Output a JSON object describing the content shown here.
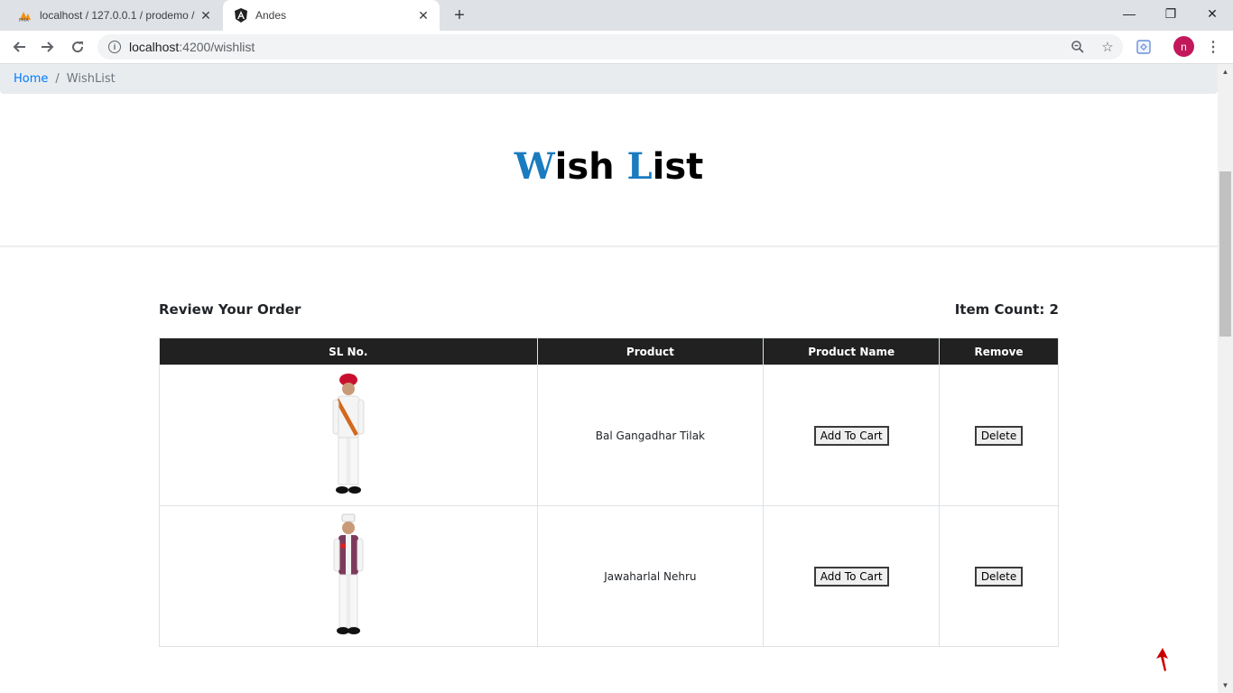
{
  "browser": {
    "tabs": [
      {
        "title": "localhost / 127.0.0.1 / prodemo / ",
        "favicon": "phpmyadmin-icon",
        "active": false
      },
      {
        "title": "Andes",
        "favicon": "angular-icon",
        "active": true
      }
    ],
    "address": {
      "host": "localhost",
      "path": ":4200/wishlist"
    },
    "avatar_initial": "n"
  },
  "breadcrumb": {
    "home": "Home",
    "separator": "/",
    "current": "WishList"
  },
  "heading": {
    "first_cap": "W",
    "first_rest": "ish ",
    "second_cap": "L",
    "second_rest": "ist"
  },
  "review_title": "Review Your Order",
  "item_count": "Item Count: 2",
  "table": {
    "headers": [
      "SL No.",
      "Product",
      "Product Name",
      "Remove"
    ],
    "rows": [
      {
        "image": "child-costume-tilak-image",
        "name": "Bal Gangadhar Tilak",
        "cart_label": "Add To Cart",
        "delete_label": "Delete"
      },
      {
        "image": "child-costume-nehru-image",
        "name": "Jawaharlal Nehru",
        "cart_label": "Add To Cart",
        "delete_label": "Delete"
      }
    ]
  },
  "colors": {
    "accent": "#1a7bbf",
    "link": "#007bff",
    "header_bg": "#212121",
    "scroll_top_arrow": "#cc0000"
  }
}
